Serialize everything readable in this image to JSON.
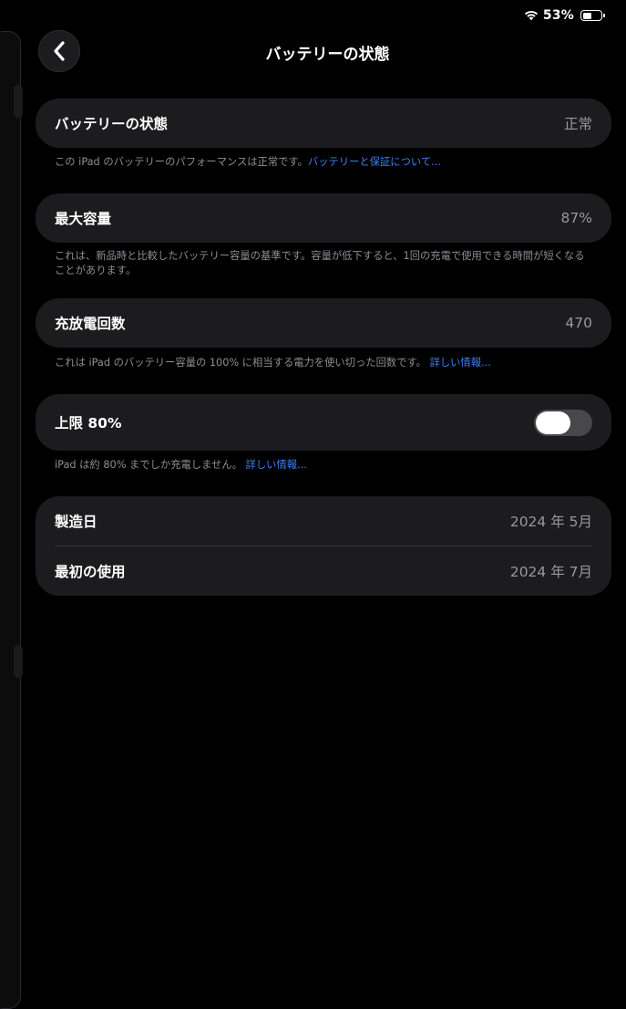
{
  "status_bar": {
    "battery_percent": "53%",
    "battery_level": 0.53,
    "icons": [
      "wifi-icon",
      "battery-icon"
    ]
  },
  "nav": {
    "title": "バッテリーの状態",
    "back_icon": "chevron-left-icon"
  },
  "battery_health": {
    "label": "バッテリーの状態",
    "value": "正常",
    "footnote": "この iPad のバッテリーのパフォーマンスは正常です。",
    "footnote_link": "バッテリーと保証について..."
  },
  "max_capacity": {
    "label": "最大容量",
    "value": "87%",
    "footnote": "これは、新品時と比較したバッテリー容量の基準です。容量が低下すると、1回の充電で使用できる時間が短くなることがあります。"
  },
  "cycle_count": {
    "label": "充放電回数",
    "value": "470",
    "footnote": "これは iPad のバッテリー容量の 100% に相当する電力を使い切った回数です。",
    "footnote_link": "詳しい情報..."
  },
  "charge_limit": {
    "label": "上限 80%",
    "toggle_on": false,
    "footnote": "iPad は約 80% までしか充電しません。",
    "footnote_link": "詳しい情報..."
  },
  "dates": {
    "manufactured_label": "製造日",
    "manufactured_value": "2024 年 5月",
    "first_use_label": "最初の使用",
    "first_use_value": "2024 年 7月"
  },
  "colors": {
    "background": "#000000",
    "card": "#1c1c1e",
    "secondary_text": "#98989d",
    "link": "#3b82f6",
    "toggle_off": "#48484a"
  }
}
